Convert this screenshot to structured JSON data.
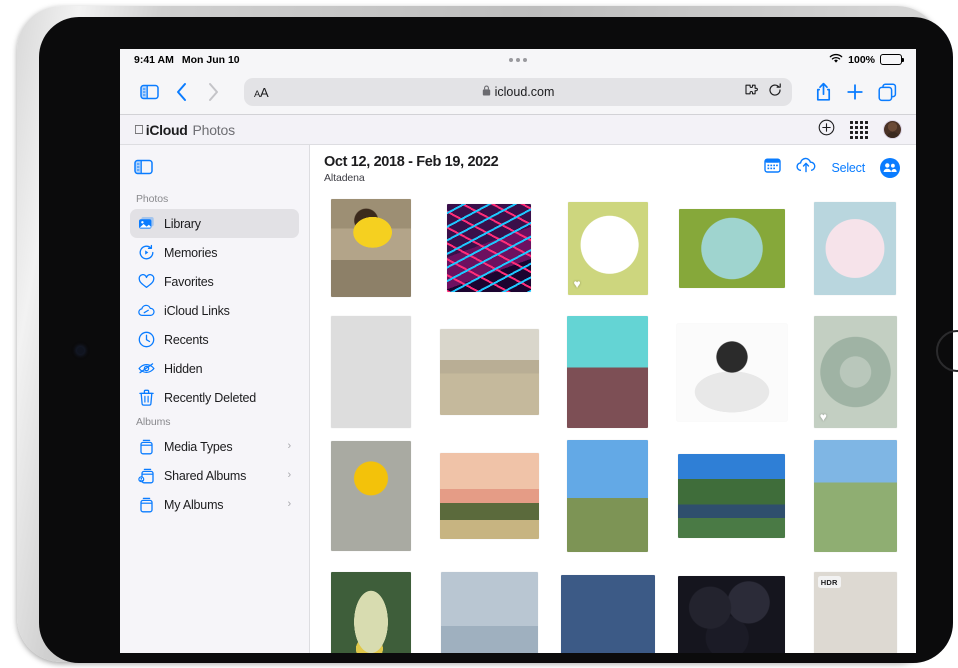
{
  "status_bar": {
    "time": "9:41 AM",
    "date": "Mon Jun 10",
    "battery_percent": "100%",
    "wifi_icon": "wifi-icon",
    "battery_icon": "battery-icon",
    "multitask_icon": "multitask-dots-icon"
  },
  "safari": {
    "sidebar_icon": "sidebar-toggle-icon",
    "back_icon": "chevron-left-icon",
    "forward_icon": "chevron-right-icon",
    "aa_label": "AA",
    "lock_icon": "lock-icon",
    "url": "icloud.com",
    "extensions_icon": "puzzle-piece-icon",
    "reload_icon": "reload-icon",
    "share_icon": "share-icon",
    "new_tab_icon": "plus-icon",
    "tabs_icon": "tabs-icon"
  },
  "icloud_bar": {
    "apple_logo": "",
    "brand": "iCloud",
    "app_name": "Photos",
    "add_icon": "plus-circle-icon",
    "apps_grid_icon": "apps-grid-icon",
    "avatar": "user-avatar"
  },
  "sidebar": {
    "toggle_icon": "sidebar-collapse-icon",
    "sections": [
      {
        "title": "Photos",
        "items": [
          {
            "label": "Library",
            "icon": "photo-stack-icon",
            "active": true,
            "chevron": false
          },
          {
            "label": "Memories",
            "icon": "memories-play-icon",
            "active": false,
            "chevron": false
          },
          {
            "label": "Favorites",
            "icon": "heart-icon",
            "active": false,
            "chevron": false
          },
          {
            "label": "iCloud Links",
            "icon": "cloud-link-icon",
            "active": false,
            "chevron": false
          },
          {
            "label": "Recents",
            "icon": "clock-icon",
            "active": false,
            "chevron": false
          },
          {
            "label": "Hidden",
            "icon": "eye-slash-icon",
            "active": false,
            "chevron": false
          },
          {
            "label": "Recently Deleted",
            "icon": "trash-icon",
            "active": false,
            "chevron": false
          }
        ]
      },
      {
        "title": "Albums",
        "items": [
          {
            "label": "Media Types",
            "icon": "album-box-icon",
            "active": false,
            "chevron": true
          },
          {
            "label": "Shared Albums",
            "icon": "shared-album-box-icon",
            "active": false,
            "chevron": true
          },
          {
            "label": "My Albums",
            "icon": "album-box-icon",
            "active": false,
            "chevron": true
          }
        ]
      }
    ]
  },
  "content": {
    "date_range": "Oct 12, 2018 - Feb 19, 2022",
    "place": "Altadena",
    "calendar_icon": "calendar-icon",
    "upload_icon": "cloud-upload-icon",
    "select_label": "Select",
    "shared_badge_icon": "people-shared-icon",
    "hdr_badge_label": "HDR",
    "favorite_icon": "heart-filled-icon"
  },
  "photos": [
    {
      "name": "photo-kid-in-water",
      "art": "p-kid",
      "w": 80,
      "h": 98,
      "favorite": false,
      "hdr": false
    },
    {
      "name": "photo-neon-burgers-sign",
      "art": "p-neon",
      "w": 84,
      "h": 88,
      "favorite": false,
      "hdr": false
    },
    {
      "name": "photo-pastries-plate",
      "art": "p-pastry",
      "w": 80,
      "h": 93,
      "favorite": true,
      "hdr": false
    },
    {
      "name": "photo-dessert-plate",
      "art": "p-dessert",
      "w": 106,
      "h": 79,
      "favorite": false,
      "hdr": false
    },
    {
      "name": "photo-macarons-plate",
      "art": "p-macaron",
      "w": 82,
      "h": 93,
      "favorite": false,
      "hdr": false
    },
    {
      "name": "photo-canyon-hiker",
      "art": "p-canyon",
      "w": 80,
      "h": 112,
      "favorite": false,
      "hdr": false
    },
    {
      "name": "photo-desert-landscape",
      "art": "p-desert",
      "w": 99,
      "h": 86,
      "favorite": false,
      "hdr": false
    },
    {
      "name": "photo-pink-cake",
      "art": "p-cake",
      "w": 81,
      "h": 112,
      "favorite": false,
      "hdr": false
    },
    {
      "name": "photo-portrait-bw",
      "art": "p-bw",
      "w": 110,
      "h": 97,
      "favorite": false,
      "hdr": false
    },
    {
      "name": "photo-succulent",
      "art": "p-succulent",
      "w": 83,
      "h": 112,
      "favorite": true,
      "hdr": false
    },
    {
      "name": "photo-yellow-sunflower",
      "art": "p-sunflower",
      "w": 80,
      "h": 110,
      "favorite": false,
      "hdr": false
    },
    {
      "name": "photo-man-at-sunset",
      "art": "p-sunsetman",
      "w": 99,
      "h": 86,
      "favorite": false,
      "hdr": false
    },
    {
      "name": "photo-pink-dress-field",
      "art": "p-pinkdress",
      "w": 81,
      "h": 112,
      "favorite": false,
      "hdr": false
    },
    {
      "name": "photo-mountain-valley",
      "art": "p-valley",
      "w": 107,
      "h": 84,
      "favorite": false,
      "hdr": false
    },
    {
      "name": "photo-woman-portrait",
      "art": "p-portrait",
      "w": 83,
      "h": 112,
      "favorite": false,
      "hdr": false
    },
    {
      "name": "photo-cactus-flower",
      "art": "p-cactusflower",
      "w": 80,
      "h": 96,
      "favorite": false,
      "hdr": false
    },
    {
      "name": "photo-man-in-clouds",
      "art": "p-manclouds",
      "w": 97,
      "h": 96,
      "favorite": false,
      "hdr": false
    },
    {
      "name": "photo-vase-still-life",
      "art": "p-vase",
      "w": 94,
      "h": 90,
      "favorite": false,
      "hdr": false
    },
    {
      "name": "photo-dark-berries",
      "art": "p-berries",
      "w": 107,
      "h": 88,
      "favorite": false,
      "hdr": false
    },
    {
      "name": "photo-doorway-portrait",
      "art": "p-doorway",
      "w": 83,
      "h": 96,
      "favorite": false,
      "hdr": true
    }
  ]
}
